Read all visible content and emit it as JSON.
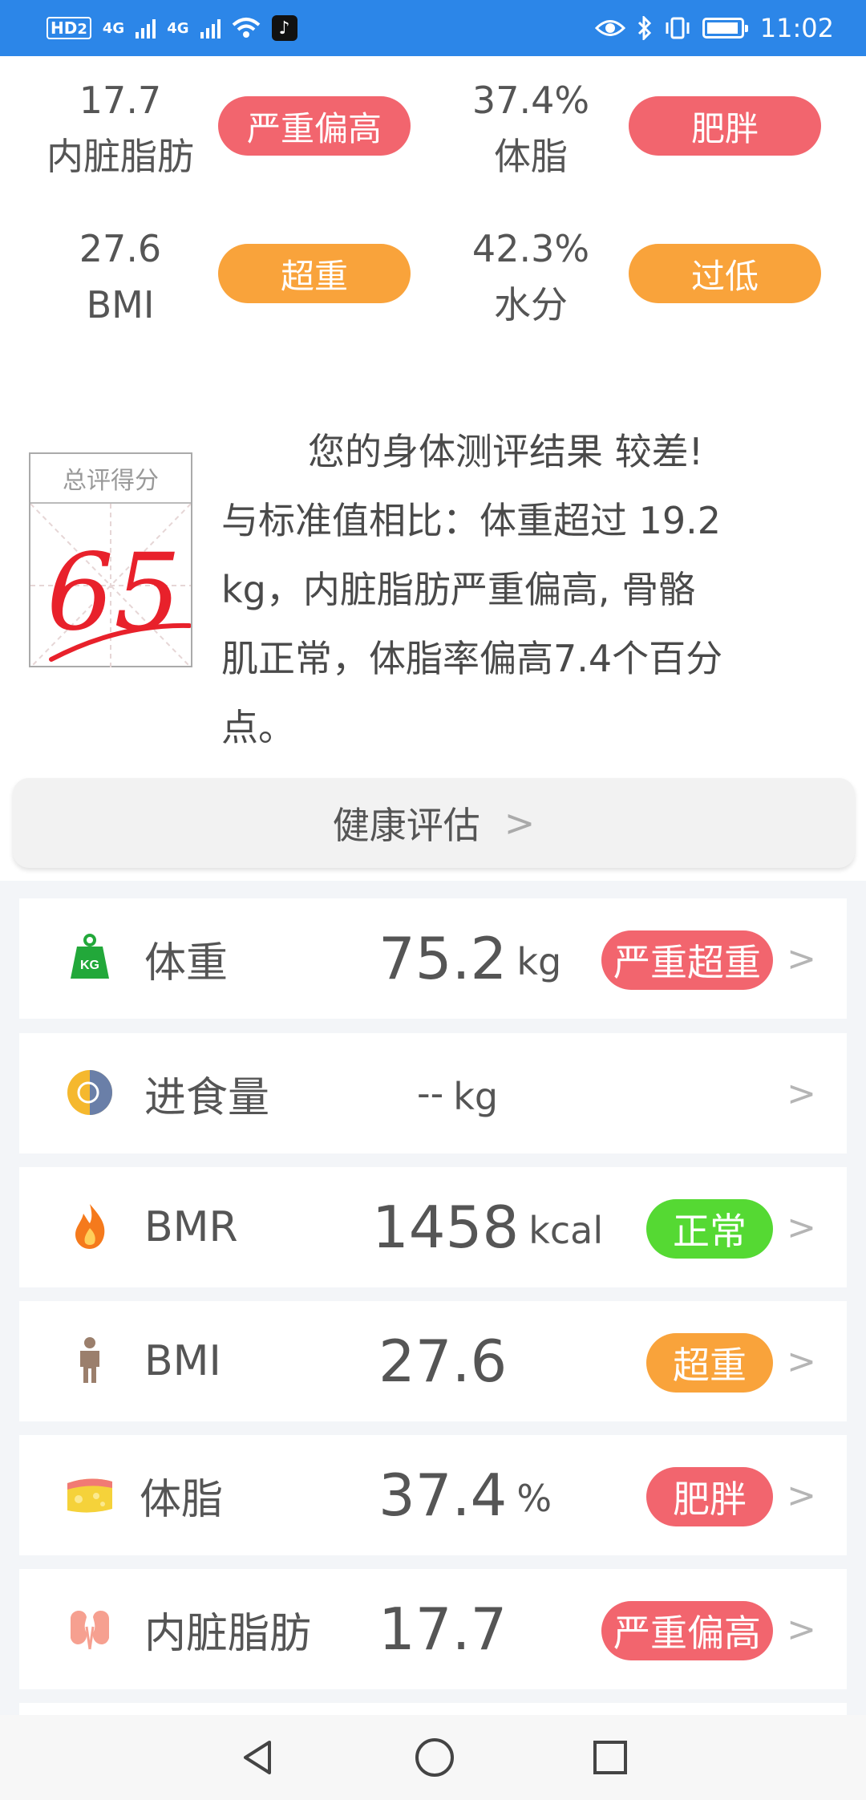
{
  "status_bar": {
    "hd": "HD",
    "hd_sub": "2",
    "net1": "4G",
    "net2": "4G",
    "time": "11:02"
  },
  "metrics": [
    {
      "value": "17.7",
      "name": "内脏脂肪",
      "status": "严重偏高",
      "color": "#f2656e"
    },
    {
      "value": "37.4%",
      "name": "体脂",
      "status": "肥胖",
      "color": "#f2656e"
    },
    {
      "value": "27.6",
      "name": "BMI",
      "status": "超重",
      "color": "#f9a33b"
    },
    {
      "value": "42.3%",
      "name": "水分",
      "status": "过低",
      "color": "#f9a33b"
    }
  ],
  "score": {
    "label": "总评得分",
    "value": "65"
  },
  "summary": {
    "line1": "您的身体测评结果 较差!",
    "line2": "与标准值相比：体重超过 19.2",
    "line3": "kg，内脏脂肪严重偏高, 骨骼",
    "line4": "肌正常，体脂率偏高7.4个百分",
    "line5": "点。"
  },
  "assess_button": {
    "label": "健康评估",
    "chevron": ">"
  },
  "rows": [
    {
      "icon": "kg-weight-icon",
      "label": "体重",
      "value": "75.2",
      "unit": "kg",
      "status": "严重超重",
      "color": "#f2656e"
    },
    {
      "icon": "food-intake-icon",
      "label": "进食量",
      "value": "--",
      "unit": "kg",
      "status": "",
      "color": ""
    },
    {
      "icon": "flame-icon",
      "label": "BMR",
      "value": "1458",
      "unit": "kcal",
      "status": "正常",
      "color": "#55d933"
    },
    {
      "icon": "person-icon",
      "label": "BMI",
      "value": "27.6",
      "unit": "",
      "status": "超重",
      "color": "#f9a33b"
    },
    {
      "icon": "fat-tissue-icon",
      "label": "体脂",
      "value": "37.4",
      "unit": "%",
      "status": "肥胖",
      "color": "#f2656e"
    },
    {
      "icon": "kidney-icon",
      "label": "内脏脂肪",
      "value": "17.7",
      "unit": "",
      "status": "严重偏高",
      "color": "#f2656e"
    }
  ],
  "chevron": ">"
}
